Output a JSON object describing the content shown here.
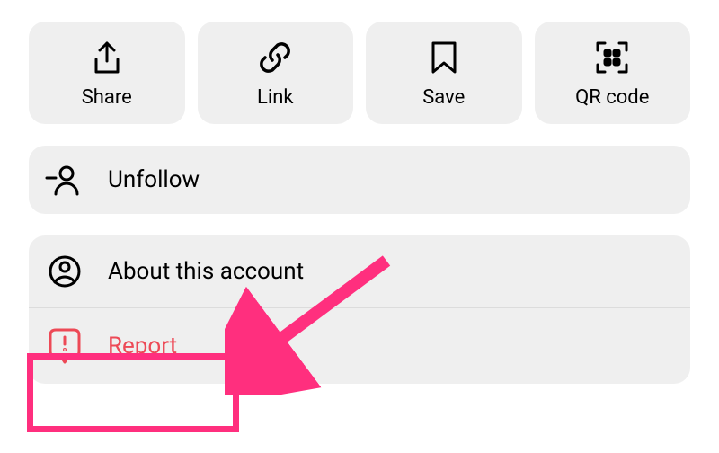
{
  "actions_row": {
    "share": {
      "label": "Share"
    },
    "link": {
      "label": "Link"
    },
    "save": {
      "label": "Save"
    },
    "qr_code": {
      "label": "QR code"
    }
  },
  "list": {
    "unfollow": {
      "label": "Unfollow"
    },
    "about": {
      "label": "About this account"
    },
    "report": {
      "label": "Report"
    }
  },
  "colors": {
    "card_bg": "#efefef",
    "text": "#000000",
    "report_text": "#ed4956",
    "annotation": "#ff2f7e"
  }
}
